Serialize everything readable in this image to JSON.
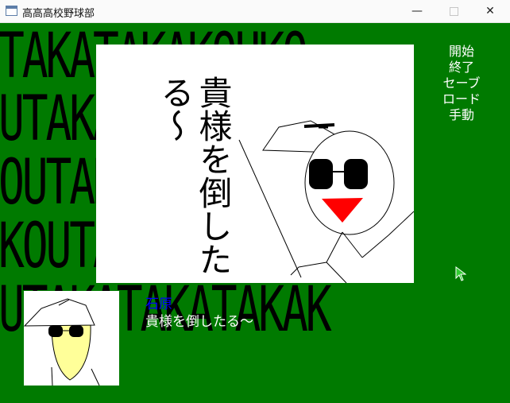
{
  "window": {
    "title": "高高高校野球部",
    "minimize_label": "—",
    "close_label": "✕"
  },
  "background": {
    "rows": [
      "TAKATAKAKOUKO",
      "UTAKATAKAKOUK",
      "OUTAKATAKAKOU",
      "KOUTAKATAKAKO",
      "UTAKATAKATAKAK"
    ],
    "color": "#007a00"
  },
  "scene": {
    "caption": "貴様を倒したる〜"
  },
  "menu": {
    "items": [
      "開始",
      "終了",
      "セーブ",
      "ロード",
      "手動"
    ]
  },
  "dialogue": {
    "speaker": "石原",
    "text": "貴様を倒したる〜"
  },
  "icons": [
    "app-icon",
    "minimize-icon",
    "maximize-icon",
    "close-icon",
    "mouse-cursor-icon"
  ]
}
